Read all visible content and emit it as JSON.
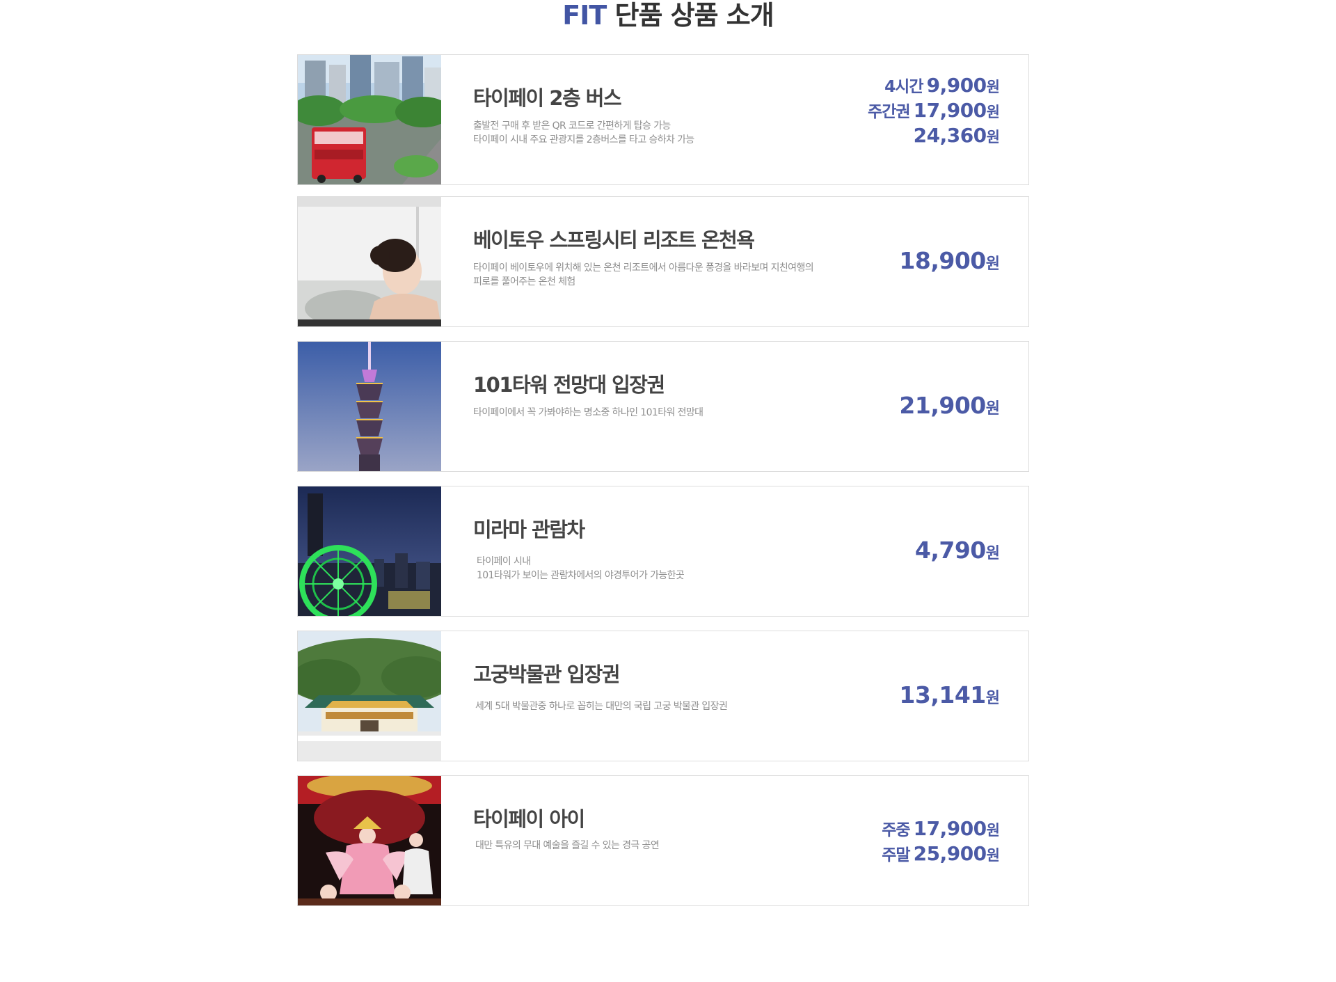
{
  "title": {
    "accent": "FIT",
    "rest": " 단품 상품 소개"
  },
  "products": [
    {
      "name": "타이페이 2층 버스",
      "desc": [
        "출발전 구매 후 받은 QR 코드로 간편하게 탑승 가능",
        "타이페이 시내 주요 관광지를 2층버스를 타고 승하차 가능"
      ],
      "prices": [
        {
          "label": "4시간",
          "value": "9,900",
          "unit": "원"
        },
        {
          "label": "주간권",
          "value": "17,900",
          "unit": "원"
        },
        {
          "label": "",
          "value": "24,360",
          "unit": "원"
        }
      ]
    },
    {
      "name": "베이토우 스프링시티 리조트 온천욕",
      "desc": [
        "타이페이 베이토우에 위치해 있는 온천 리조트에서 아름다운 풍경을 바라보며 지친여행의",
        "피로를 풀어주는 온천 체험"
      ],
      "prices": [
        {
          "label": "",
          "value": "18,900",
          "unit": "원"
        }
      ]
    },
    {
      "name": "101타워 전망대 입장권",
      "desc": [
        "타이페이에서 꼭 가봐야하는 명소중 하나인 101타워 전망대"
      ],
      "prices": [
        {
          "label": "",
          "value": "21,900",
          "unit": "원"
        }
      ]
    },
    {
      "name": "미라마 관람차",
      "desc": [
        "타이페이 시내",
        "101타워가 보이는 관람차에서의 야경투어가 가능한곳"
      ],
      "prices": [
        {
          "label": "",
          "value": "4,790",
          "unit": "원"
        }
      ]
    },
    {
      "name": "고궁박물관 입장권",
      "desc": [
        "세계 5대 박물관중 하나로 꼽히는 대만의 국립 고궁 박물관 입장권"
      ],
      "prices": [
        {
          "label": "",
          "value": "13,141",
          "unit": "원"
        }
      ]
    },
    {
      "name": "타이페이 아이",
      "desc": [
        "대만 특유의 무대 예술을 즐길 수 있는 경극 공연"
      ],
      "prices": [
        {
          "label": "주중",
          "value": "17,900",
          "unit": "원"
        },
        {
          "label": "주말",
          "value": "25,900",
          "unit": "원"
        }
      ]
    }
  ],
  "colors": {
    "accent": "#4255a4",
    "price": "#4b5aa6",
    "border": "#dcdcdc",
    "desc": "#8e8e8e",
    "name": "#444444"
  },
  "icons": [
    "double-decker-bus-photo",
    "hot-spring-woman-photo",
    "taipei-101-tower-photo",
    "miramar-ferris-wheel-photo",
    "national-palace-museum-photo",
    "chinese-opera-performance-photo"
  ]
}
